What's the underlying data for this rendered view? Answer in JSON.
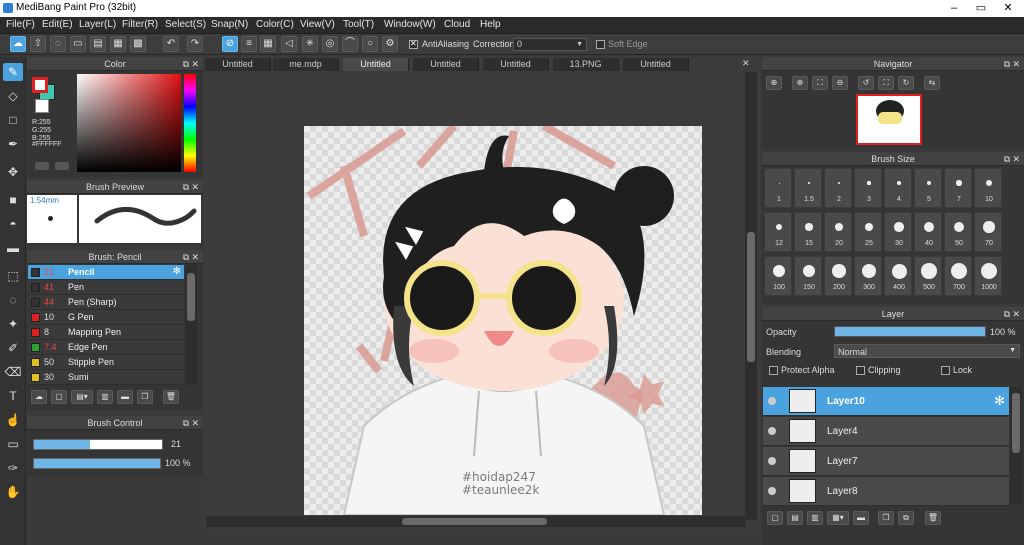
{
  "window": {
    "title": "MediBang Paint Pro (32bit)"
  },
  "menu": [
    "File(F)",
    "Edit(E)",
    "Layer(L)",
    "Filter(R)",
    "Select(S)",
    "Snap(N)",
    "Color(C)",
    "View(V)",
    "Tool(T)",
    "Window(W)",
    "Cloud",
    "Help"
  ],
  "toolbar": {
    "antialiasing_label": "AntiAliasing",
    "correction_label": "Correction",
    "correction_value": "0",
    "soft_edge_label": "Soft Edge"
  },
  "color_panel": {
    "title": "Color",
    "r": "R:255",
    "g": "G:255",
    "b": "B:255",
    "hex": "#FFFFFF",
    "fg_color": "#e02020",
    "bg_color": "#3ec9b2"
  },
  "brush_preview": {
    "title": "Brush Preview",
    "size": "1.54mm"
  },
  "brush_panel": {
    "title": "Brush: Pencil",
    "brushes": [
      {
        "size": "21",
        "name": "Pencil",
        "color": "#333333"
      },
      {
        "size": "41",
        "name": "Pen",
        "color": "#333333"
      },
      {
        "size": "44",
        "name": "Pen (Sharp)",
        "color": "#333333"
      },
      {
        "size": "10",
        "name": "G Pen",
        "color": "#e02020"
      },
      {
        "size": "8",
        "name": "Mapping Pen",
        "color": "#e02020"
      },
      {
        "size": "7.4",
        "name": "Edge Pen",
        "color": "#2ea02e"
      },
      {
        "size": "50",
        "name": "Stipple Pen",
        "color": "#e0c020"
      },
      {
        "size": "30",
        "name": "Sumi",
        "color": "#e0c020"
      }
    ]
  },
  "brush_control": {
    "title": "Brush Control",
    "size_value": "21",
    "opacity_value": "100 %",
    "size_fraction": 0.44,
    "opacity_fraction": 1.0
  },
  "doc_tabs": [
    "Untitled",
    "me.mdp",
    "Untitled",
    "Untitled",
    "Untitled",
    "13.PNG",
    "Untitled"
  ],
  "canvas": {
    "watermark_line1": "#hoidap247",
    "watermark_line2": "#teaunlee2k"
  },
  "navigator": {
    "title": "Navigator"
  },
  "brush_size": {
    "title": "Brush Size",
    "sizes": [
      "1",
      "1.5",
      "2",
      "3",
      "4",
      "5",
      "7",
      "10",
      "12",
      "15",
      "20",
      "25",
      "30",
      "40",
      "50",
      "70",
      "100",
      "150",
      "200",
      "300",
      "400",
      "500",
      "700",
      "1000"
    ]
  },
  "layer_panel": {
    "title": "Layer",
    "opacity_label": "Opacity",
    "opacity_value": "100 %",
    "blending_label": "Blending",
    "blending_value": "Normal",
    "protect_alpha_label": "Protect Alpha",
    "clipping_label": "Clipping",
    "lock_label": "Lock",
    "layers": [
      "Layer10",
      "Layer4",
      "Layer7",
      "Layer8"
    ]
  }
}
